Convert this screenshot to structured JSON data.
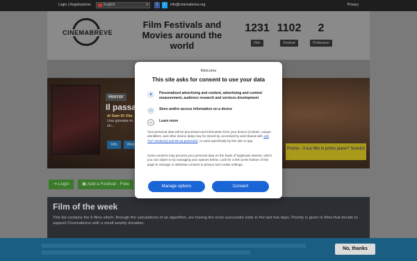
{
  "topbar": {
    "login": "Login | Registrazione",
    "language": "English",
    "email": "info@cinemabreve.org",
    "privacy": "Privacy"
  },
  "header": {
    "logo_text": "CINEMABREVE",
    "tagline": "Film Festivals and Movies around the world",
    "stats": [
      {
        "value": "1231",
        "label": "Film"
      },
      {
        "value": "1102",
        "label": "Festival"
      },
      {
        "value": "2",
        "label": "Profession"
      }
    ]
  },
  "hero": {
    "genre": "Horror",
    "title": "Il passa",
    "byline_prefix": "di Sam Di Vita",
    "byline_rest": "Una giovane m... infanzia. Nella... coperta da un...",
    "info_label": "Info",
    "web_label": "Web",
    "promo": "Promo - Il tuo film in primo piano? Scrivici!"
  },
  "actions": {
    "login_label": "Login",
    "add_festival_label": "Add a Festival - Free"
  },
  "week": {
    "title": "Film of the week",
    "description": "This list contains the 6 films which, through the calculations of an algorithm, are having the most successful visits in the last few days. Priority is given to films that decide to support Cinemabreve with a small weekly donation."
  },
  "cookiebar": {
    "no_thanks": "No, thanks"
  },
  "consent": {
    "welcome": "Welcome",
    "headline": "This site asks for consent to use your data",
    "purposes": [
      {
        "icon": "person-icon",
        "text": "Personalised advertising and content, advertising and content measurement, audience research and services development"
      },
      {
        "icon": "devices-icon",
        "text": "Store and/or access information on a device"
      },
      {
        "icon": "chevron-down-icon",
        "text": "Learn more"
      }
    ],
    "body1_pre": "Your personal data will be processed and information from your device (cookies, unique identifiers, and other device data) may be stored by, accessed by and shared with ",
    "body1_link": "132 TCF vendor(s) and 65 ad partner(s)",
    "body1_post": ", or used specifically by this site or app.",
    "body2": "Some vendors may process your personal data on the basis of legitimate interest, which you can object to by managing your options below. Look for a link at the bottom of this page to manage or withdraw consent in privacy and cookie settings.",
    "manage_label": "Manage options",
    "consent_label": "Consent"
  },
  "colors": {
    "modal_button": "#1a65d6",
    "cookie_bar": "#1b5e83",
    "promo": "#a99a1c"
  }
}
